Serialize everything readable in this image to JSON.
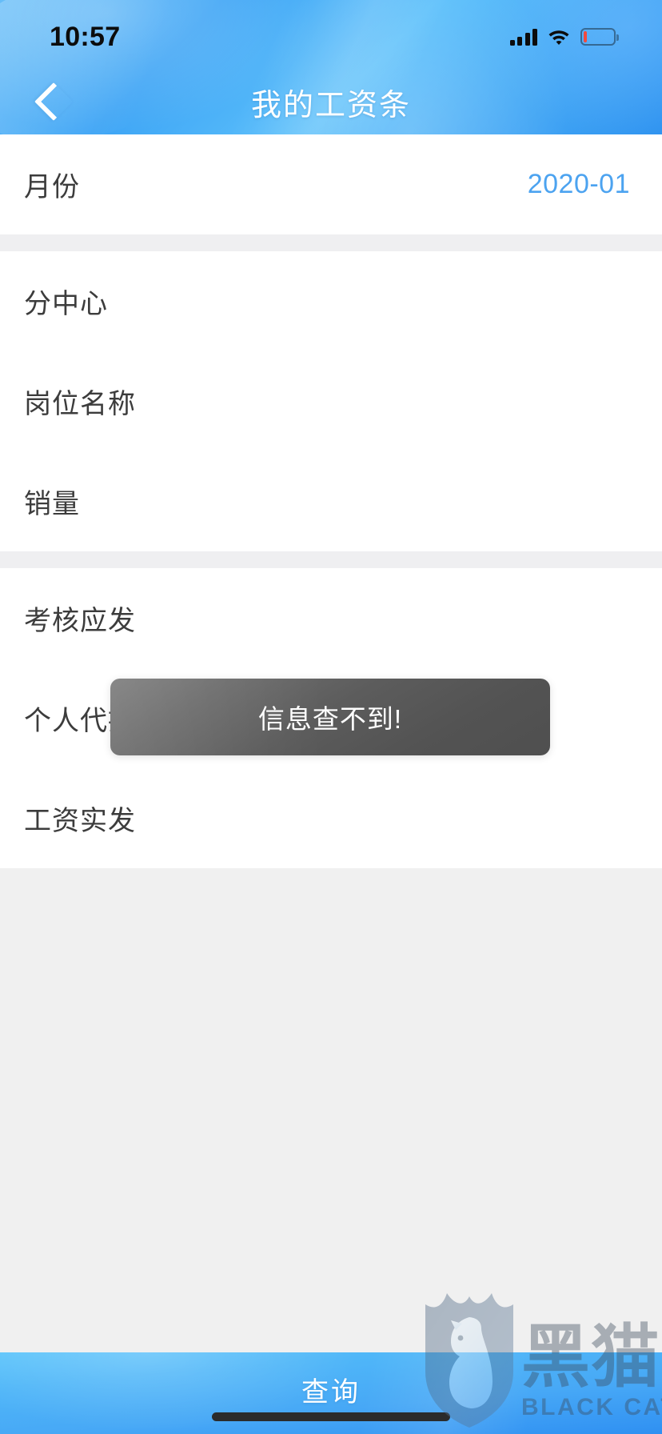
{
  "status_bar": {
    "time": "10:57",
    "signal_icon": "cellular-signal-icon",
    "wifi_icon": "wifi-icon",
    "battery_icon": "battery-low-icon"
  },
  "nav": {
    "title": "我的工资条",
    "back_icon": "chevron-left-icon"
  },
  "form": {
    "groups": [
      {
        "rows": [
          {
            "label": "月份",
            "value": "2020-01",
            "value_style": "link"
          }
        ]
      },
      {
        "rows": [
          {
            "label": "分中心",
            "value": ""
          },
          {
            "label": "岗位名称",
            "value": ""
          },
          {
            "label": "销量",
            "value": ""
          }
        ]
      },
      {
        "rows": [
          {
            "label": "考核应发",
            "value": ""
          },
          {
            "label": "个人代扣合计",
            "value": ""
          },
          {
            "label": "工资实发",
            "value": ""
          }
        ]
      }
    ]
  },
  "toast": {
    "message": "信息查不到!"
  },
  "bottom_bar": {
    "query_label": "查询"
  },
  "watermark": {
    "cn": "黑猫",
    "en": "BLACK CAT",
    "shield_icon": "black-cat-shield-icon"
  },
  "colors": {
    "header_blue": "#4fb3f7",
    "accent_link": "#4ca3f0",
    "page_bg": "#f0f0f0",
    "row_bg": "#ffffff",
    "toast_bg": "#5c5c5c",
    "label_text": "#3c3c3c",
    "battery_low": "#f24a3d"
  }
}
